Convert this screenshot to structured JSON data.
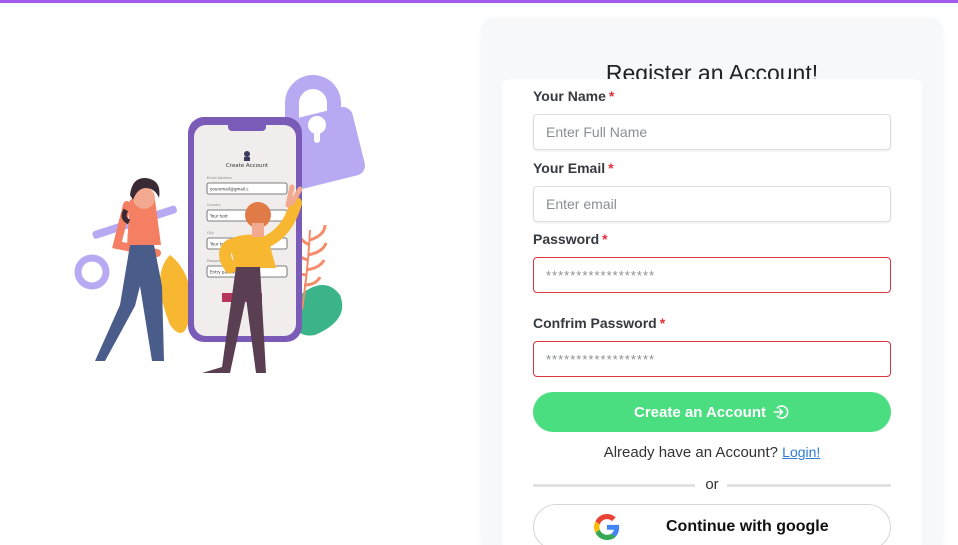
{
  "form": {
    "title": "Register an Account!",
    "required_mark": "*",
    "name": {
      "label": "Your Name",
      "placeholder": "Enter Full Name",
      "value": ""
    },
    "email": {
      "label": "Your Email",
      "placeholder": "Enter email",
      "value": ""
    },
    "password": {
      "label": "Password",
      "placeholder": "******************",
      "value": "",
      "state": "invalid"
    },
    "confirm_password": {
      "label": "Confrim Password",
      "placeholder": "******************",
      "value": "",
      "state": "invalid"
    },
    "submit_label": "Create an Account",
    "submit_icon": "login-icon",
    "login_prompt": "Already have an Account?",
    "login_link": "Login!",
    "divider_text": "or",
    "google_label": "Continue with google",
    "google_icon": "google-g-icon"
  },
  "illustration": {
    "phone_title": "Create Account",
    "phone_fields": [
      "Email Address",
      "Country",
      "City",
      "Password"
    ],
    "phone_values": [
      "youremail@gmail.c",
      "Your text",
      "Your text",
      "Entry password"
    ]
  },
  "colors": {
    "accent_bar": "#a25bf0",
    "primary_button": "#4ade80",
    "error_border": "#d9363e",
    "link": "#2f7bd8",
    "required": "#e0303a"
  }
}
